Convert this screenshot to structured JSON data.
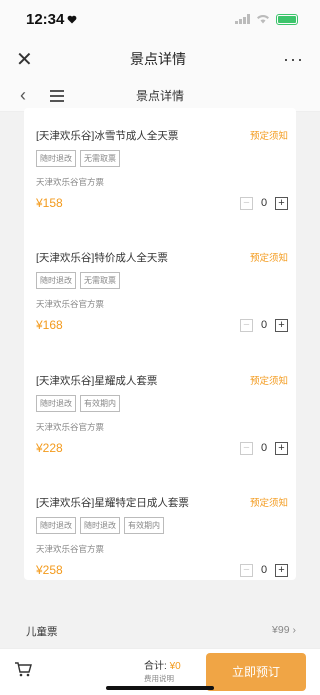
{
  "status": {
    "time": "12:34"
  },
  "header": {
    "title": "景点详情",
    "close": "✕",
    "more": "···"
  },
  "subnav": {
    "title": "景点详情"
  },
  "tickets": [
    {
      "name": "[天津欢乐谷]冰雪节成人全天票",
      "book": "预定须知",
      "tags": [
        "随时退改",
        "无需取票"
      ],
      "notice": "天津欢乐谷官方票",
      "price": "¥158",
      "qty": "0"
    },
    {
      "name": "[天津欢乐谷]特价成人全天票",
      "book": "预定须知",
      "tags": [
        "随时退改",
        "无需取票"
      ],
      "notice": "天津欢乐谷官方票",
      "price": "¥168",
      "qty": "0"
    },
    {
      "name": "[天津欢乐谷]星耀成人套票",
      "book": "预定须知",
      "tags": [
        "随时退改",
        "有效期内"
      ],
      "notice": "天津欢乐谷官方票",
      "price": "¥228",
      "qty": "0"
    },
    {
      "name": "[天津欢乐谷]星耀特定日成人套票",
      "book": "预定须知",
      "tags": [
        "随时退改",
        "随时退改",
        "有效期内"
      ],
      "notice": "天津欢乐谷官方票",
      "price": "¥258",
      "qty": "0"
    }
  ],
  "kids": {
    "label": "儿童票",
    "price": "¥99"
  },
  "bottom": {
    "total_label": "合计:",
    "total_value": "¥0",
    "explain": "费用说明",
    "submit": "立即预订"
  },
  "colors": {
    "accent": "#f39a1c",
    "battery": "#3cc46b"
  }
}
